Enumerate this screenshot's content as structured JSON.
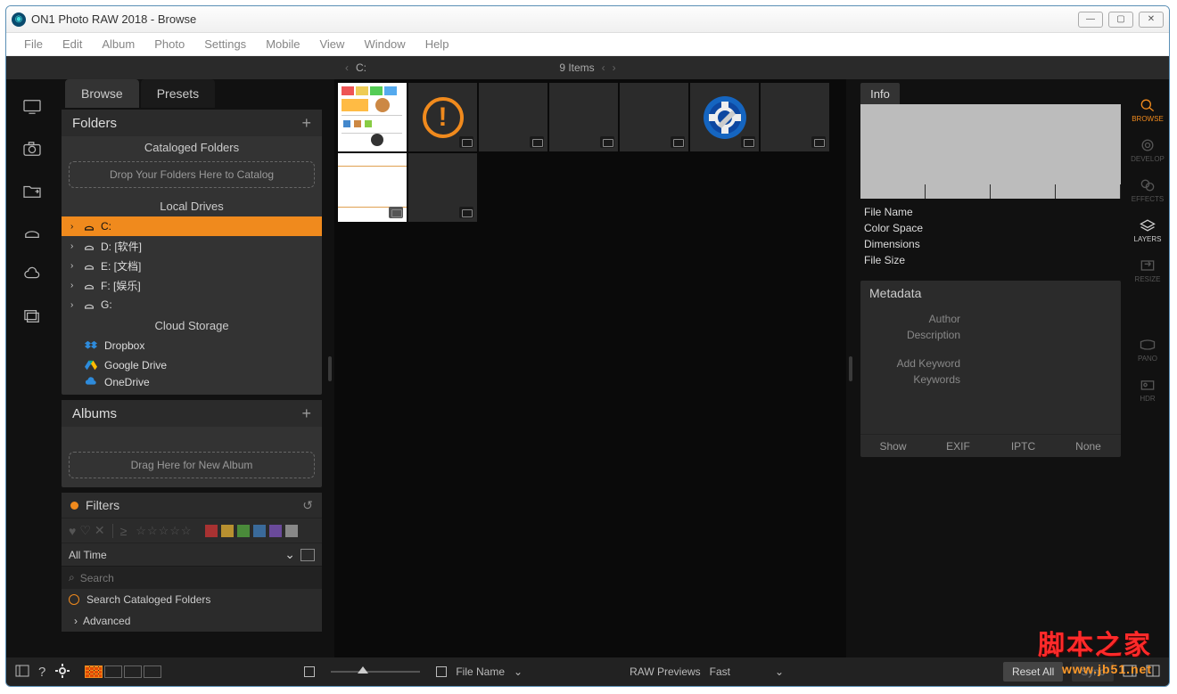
{
  "window": {
    "title": "ON1 Photo RAW 2018 - Browse"
  },
  "menu": [
    "File",
    "Edit",
    "Album",
    "Photo",
    "Settings",
    "Mobile",
    "View",
    "Window",
    "Help"
  ],
  "breadcrumb": {
    "path": "C:",
    "count": "9 Items"
  },
  "tabs": {
    "browse": "Browse",
    "presets": "Presets"
  },
  "folders": {
    "title": "Folders",
    "cataloged_header": "Cataloged Folders",
    "drop_hint": "Drop Your Folders Here to Catalog",
    "local_header": "Local Drives",
    "drives": [
      {
        "label": "C:",
        "selected": true
      },
      {
        "label": "D: [软件]",
        "selected": false
      },
      {
        "label": "E: [文档]",
        "selected": false
      },
      {
        "label": "F: [娱乐]",
        "selected": false
      },
      {
        "label": "G:",
        "selected": false
      }
    ],
    "cloud_header": "Cloud Storage",
    "clouds": [
      {
        "label": "Dropbox",
        "color": "#2e8bdb"
      },
      {
        "label": "Google Drive",
        "color": "#f0b429"
      },
      {
        "label": "OneDrive",
        "color": "#2e8bdb"
      }
    ]
  },
  "albums": {
    "title": "Albums",
    "drop_hint": "Drag Here for New Album"
  },
  "filters": {
    "title": "Filters",
    "all_time": "All Time",
    "search_placeholder": "Search",
    "search_cataloged": "Search Cataloged Folders",
    "advanced": "Advanced",
    "colors": [
      "#a83232",
      "#b89030",
      "#4a8a3a",
      "#3a6a9a",
      "#6a4a9a",
      "#888"
    ]
  },
  "info": {
    "tab": "Info",
    "fields": [
      "File Name",
      "Color Space",
      "Dimensions",
      "File Size"
    ]
  },
  "metadata": {
    "title": "Metadata",
    "rows": [
      "Author",
      "Description",
      "Add Keyword",
      "Keywords"
    ],
    "tabs": [
      "Show",
      "EXIF",
      "IPTC",
      "None"
    ]
  },
  "right_rail": [
    {
      "label": "BROWSE",
      "active": true
    },
    {
      "label": "DEVELOP",
      "active": false
    },
    {
      "label": "EFFECTS",
      "active": false
    },
    {
      "label": "LAYERS",
      "active": false
    },
    {
      "label": "RESIZE",
      "active": false
    },
    {
      "label": "",
      "active": false
    },
    {
      "label": "PANO",
      "active": false
    },
    {
      "label": "HDR",
      "active": false
    }
  ],
  "statusbar": {
    "sort_label": "File Name",
    "raw_label": "RAW Previews",
    "raw_value": "Fast",
    "reset": "Reset All",
    "sync": "Sync"
  },
  "watermark": {
    "line1": "脚本之家",
    "line2": "www.jb51.net"
  }
}
